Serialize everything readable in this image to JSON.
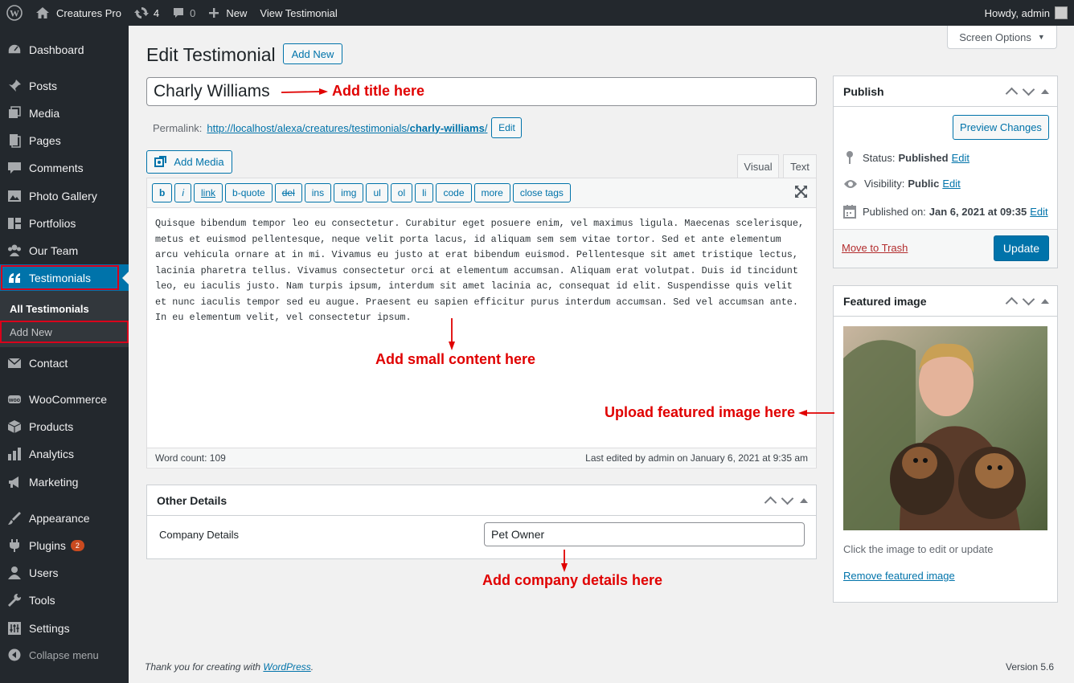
{
  "adminbar": {
    "site_name": "Creatures Pro",
    "updates_count": "4",
    "comments_count": "0",
    "new_label": "New",
    "view_label": "View Testimonial",
    "howdy": "Howdy, admin"
  },
  "sidebar": {
    "items": [
      {
        "label": "Dashboard",
        "icon": "dashboard-icon"
      },
      {
        "label": "Posts",
        "icon": "pin-icon"
      },
      {
        "label": "Media",
        "icon": "media-icon"
      },
      {
        "label": "Pages",
        "icon": "pages-icon"
      },
      {
        "label": "Comments",
        "icon": "comment-icon"
      },
      {
        "label": "Photo Gallery",
        "icon": "gallery-icon"
      },
      {
        "label": "Portfolios",
        "icon": "portfolio-icon"
      },
      {
        "label": "Our Team",
        "icon": "team-icon"
      },
      {
        "label": "Testimonials",
        "icon": "quote-icon"
      },
      {
        "label": "Contact",
        "icon": "mail-icon"
      },
      {
        "label": "WooCommerce",
        "icon": "woo-icon"
      },
      {
        "label": "Products",
        "icon": "products-icon"
      },
      {
        "label": "Analytics",
        "icon": "analytics-icon"
      },
      {
        "label": "Marketing",
        "icon": "marketing-icon"
      },
      {
        "label": "Appearance",
        "icon": "appearance-icon"
      },
      {
        "label": "Plugins",
        "icon": "plugins-icon"
      },
      {
        "label": "Users",
        "icon": "users-icon"
      },
      {
        "label": "Tools",
        "icon": "tools-icon"
      },
      {
        "label": "Settings",
        "icon": "settings-icon"
      }
    ],
    "plugins_badge": "2",
    "submenu": {
      "all": "All Testimonials",
      "add_new": "Add New"
    },
    "collapse": "Collapse menu"
  },
  "screen_options": "Screen Options",
  "page": {
    "heading": "Edit Testimonial",
    "add_new": "Add New",
    "title_value": "Charly Williams",
    "permalink_label": "Permalink:",
    "permalink_base": "http://localhost/alexa/creatures/testimonials/",
    "permalink_slug": "charly-williams",
    "permalink_tail": "/",
    "edit_label": "Edit"
  },
  "editor": {
    "add_media": "Add Media",
    "tab_visual": "Visual",
    "tab_text": "Text",
    "quicktags": [
      "b",
      "i",
      "link",
      "b-quote",
      "del",
      "ins",
      "img",
      "ul",
      "ol",
      "li",
      "code",
      "more",
      "close tags"
    ],
    "content": "Quisque bibendum tempor leo eu consectetur. Curabitur eget posuere enim, vel maximus ligula. Maecenas scelerisque, metus et euismod pellentesque, neque velit porta lacus, id aliquam sem sem vitae tortor. Sed et ante elementum arcu vehicula ornare at in mi. Vivamus eu justo at erat bibendum euismod. Pellentesque sit amet tristique lectus, lacinia pharetra tellus. Vivamus consectetur orci at elementum accumsan. Aliquam erat volutpat. Duis id tincidunt leo, eu iaculis justo. Nam turpis ipsum, interdum sit amet lacinia ac, consequat id elit. Suspendisse quis velit et nunc iaculis tempor sed eu augue. Praesent eu sapien efficitur purus interdum accumsan. Sed vel accumsan ante. In eu elementum velit, vel consectetur ipsum.",
    "word_count": "Word count: 109",
    "last_edited": "Last edited by admin on January 6, 2021 at 9:35 am"
  },
  "other_details": {
    "title": "Other Details",
    "company_label": "Company Details",
    "company_value": "Pet Owner"
  },
  "publish": {
    "title": "Publish",
    "preview": "Preview Changes",
    "status_label": "Status:",
    "status_value": "Published",
    "visibility_label": "Visibility:",
    "visibility_value": "Public",
    "published_label": "Published on:",
    "published_value": "Jan 6, 2021 at 09:35",
    "edit": "Edit",
    "trash": "Move to Trash",
    "update": "Update"
  },
  "featured": {
    "title": "Featured image",
    "hint": "Click the image to edit or update",
    "remove": "Remove featured image"
  },
  "annotations": {
    "title": "Add title here",
    "content": "Add small content here",
    "image": "Upload featured image here",
    "company": "Add company details here"
  },
  "footer": {
    "thanks": "Thank you for creating with ",
    "wp": "WordPress",
    "period": ".",
    "version": "Version 5.6"
  },
  "colors": {
    "admin_blue": "#0073aa",
    "sidebar_bg": "#23282d",
    "annotation_red": "#e00000"
  }
}
